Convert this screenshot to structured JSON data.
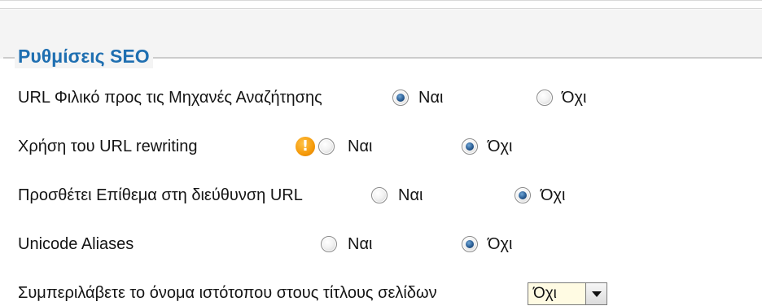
{
  "section": {
    "legend": "Ρυθμίσεις SEO"
  },
  "settings": [
    {
      "label": "URL Φιλικό προς τις Μηχανές Αναζήτησης",
      "yes_label": "Ναι",
      "no_label": "Όχι",
      "selected": "Ναι"
    },
    {
      "label": "Χρήση του URL rewriting",
      "warning_icon": "exclamation-warning-icon",
      "yes_label": "Ναι",
      "no_label": "Όχι",
      "selected": "Όχι"
    },
    {
      "label": "Προσθέτει Επίθεμα στη διεύθυνση URL",
      "yes_label": "Ναι",
      "no_label": "Όχι",
      "selected": "Όχι"
    },
    {
      "label": "Unicode Aliases",
      "yes_label": "Ναι",
      "no_label": "Όχι",
      "selected": "Όχι"
    }
  ],
  "site_name_in_title": {
    "label": "Συμπεριλάβετε το όνομα ιστότοπου στους τίτλους σελίδων",
    "selected_value": "Όχι"
  },
  "colors": {
    "legend": "#1f6fb1",
    "warning": "#f59a0a",
    "select_background": "#fffbe3"
  }
}
